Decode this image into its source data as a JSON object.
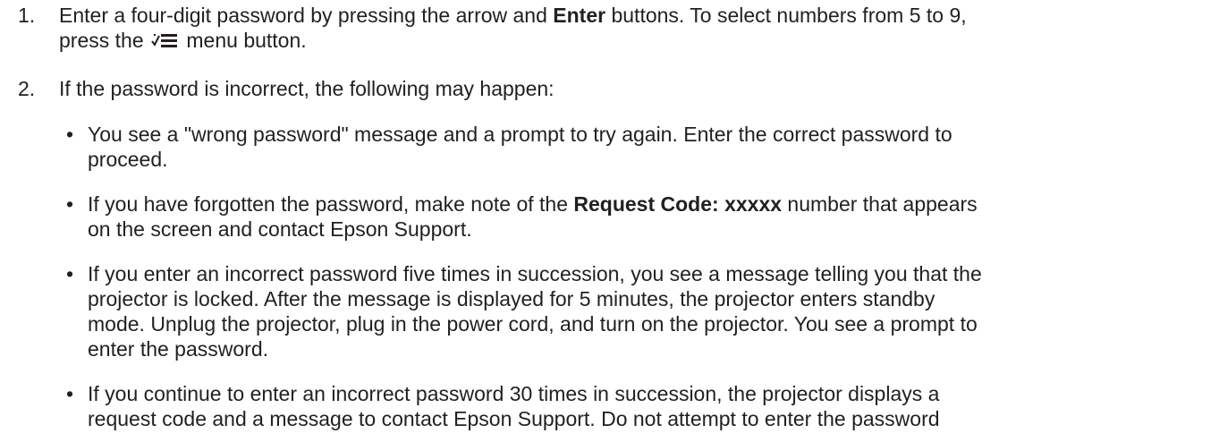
{
  "steps": [
    {
      "number": "1.",
      "text_a": "Enter a four-digit password by pressing the arrow and ",
      "bold_a": "Enter",
      "text_b": " buttons. To select numbers from 5 to 9,",
      "text_c": "press the ",
      "icon": "menu-icon",
      "text_d": " menu button."
    },
    {
      "number": "2.",
      "text": "If the password is incorrect, the following may happen:"
    }
  ],
  "bullets": [
    {
      "marker": "•",
      "line1": "You see a \"wrong password\" message and a prompt to try again. Enter the correct password to",
      "line2": "proceed."
    },
    {
      "marker": "•",
      "line1_a": "If you have forgotten the password, make note of the ",
      "line1_bold": "Request Code: xxxxx",
      "line1_b": " number that appears",
      "line2": "on the screen and contact Epson Support."
    },
    {
      "marker": "•",
      "line1": "If you enter an incorrect password five times in succession, you see a message telling you that the",
      "line2": "projector is locked. After the message is displayed for 5 minutes, the projector enters standby",
      "line3": "mode. Unplug the projector, plug in the power cord, and turn on the projector. You see a prompt to",
      "line4": "enter the password."
    },
    {
      "marker": "•",
      "line1": "If you continue to enter an incorrect password 30 times in succession, the projector displays a",
      "line2": "request code and a message to contact Epson Support. Do not attempt to enter the password"
    }
  ]
}
